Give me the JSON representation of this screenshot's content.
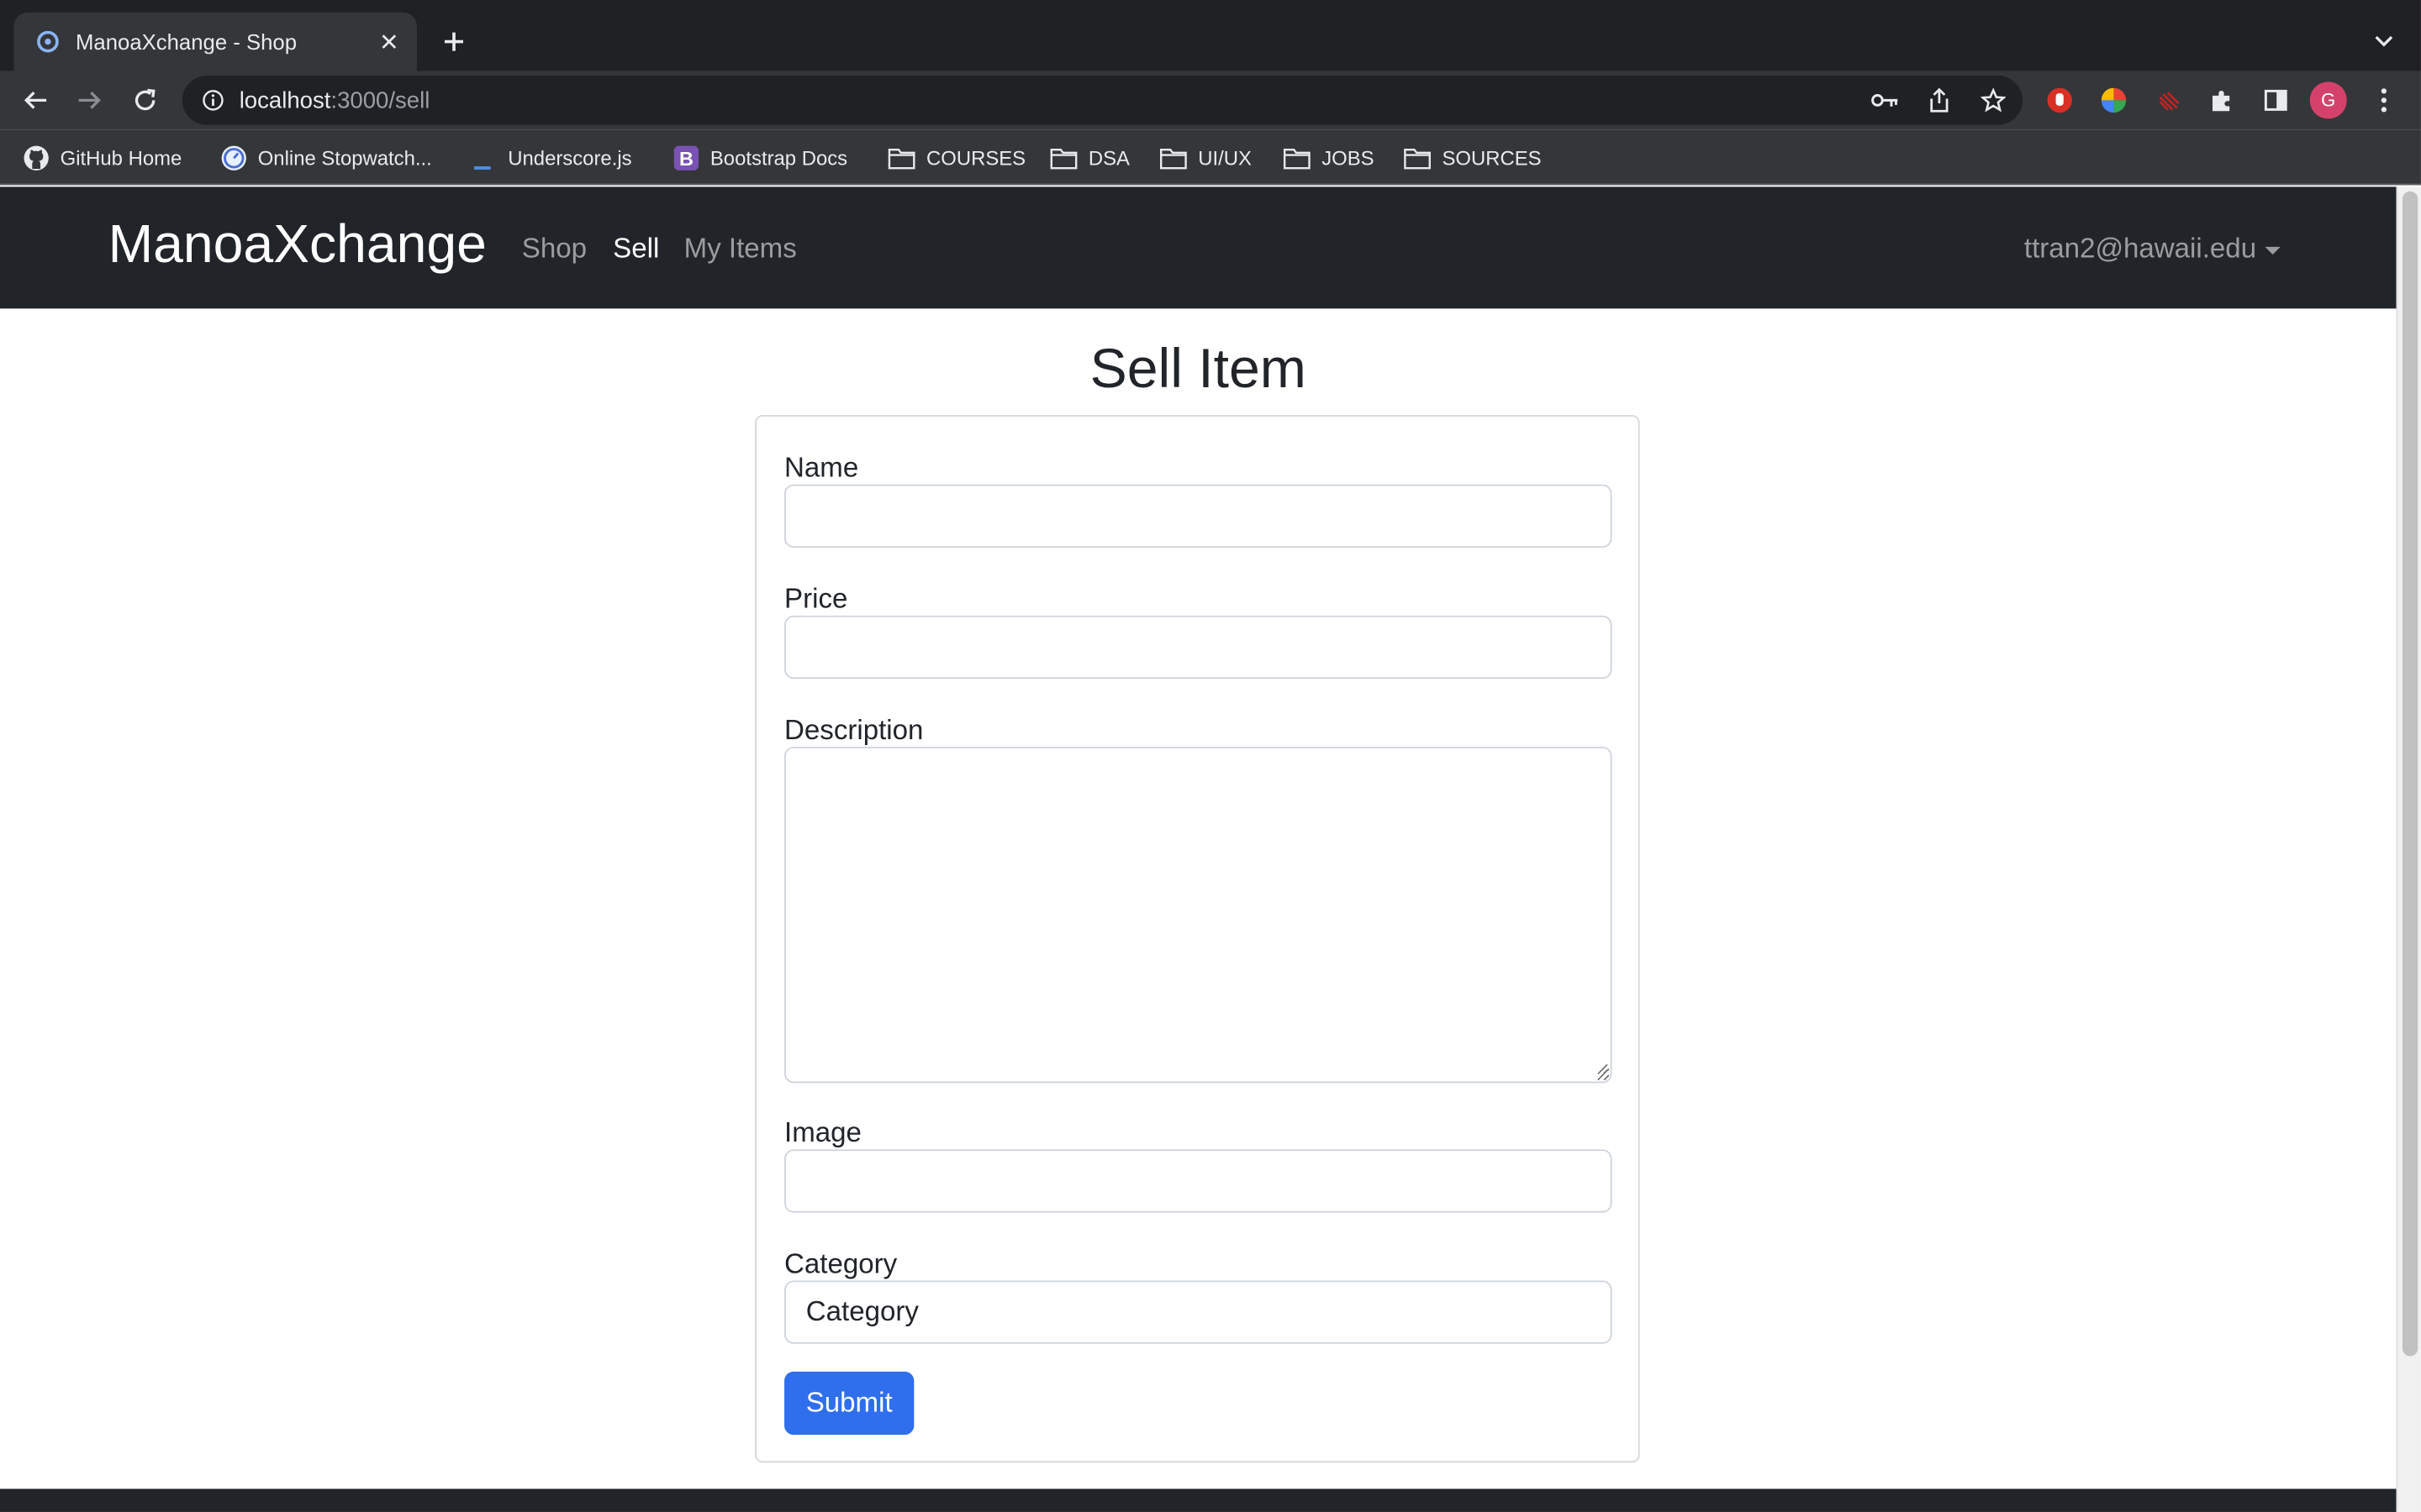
{
  "browser": {
    "tab_title": "ManoaXchange - Shop",
    "url_host": "localhost",
    "url_path": ":3000/sell",
    "profile_initial": "G",
    "bookmarks": [
      {
        "label": "GitHub Home",
        "icon": "github-icon"
      },
      {
        "label": "Online Stopwatch...",
        "icon": "stopwatch-icon"
      },
      {
        "label": "Underscore.js",
        "icon": "underscore-icon"
      },
      {
        "label": "Bootstrap Docs",
        "icon": "bootstrap-icon"
      },
      {
        "label": "COURSES",
        "icon": "folder-icon"
      },
      {
        "label": "DSA",
        "icon": "folder-icon"
      },
      {
        "label": "UI/UX",
        "icon": "folder-icon"
      },
      {
        "label": "JOBS",
        "icon": "folder-icon"
      },
      {
        "label": "SOURCES",
        "icon": "folder-icon"
      }
    ]
  },
  "navbar": {
    "brand": "ManoaXchange",
    "links": [
      {
        "label": "Shop",
        "active": false
      },
      {
        "label": "Sell",
        "active": true
      },
      {
        "label": "My Items",
        "active": false
      }
    ],
    "user": "ttran2@hawaii.edu"
  },
  "page": {
    "title": "Sell Item"
  },
  "form": {
    "name_label": "Name",
    "name_value": "",
    "price_label": "Price",
    "price_value": "",
    "description_label": "Description",
    "description_value": "",
    "image_label": "Image",
    "image_value": "",
    "category_label": "Category",
    "category_selected": "Category",
    "submit_label": "Submit"
  },
  "colors": {
    "navbar_bg": "#212529",
    "primary": "#2f6fed",
    "chrome_bg": "#35363a",
    "profile_avatar": "#d4426b"
  }
}
